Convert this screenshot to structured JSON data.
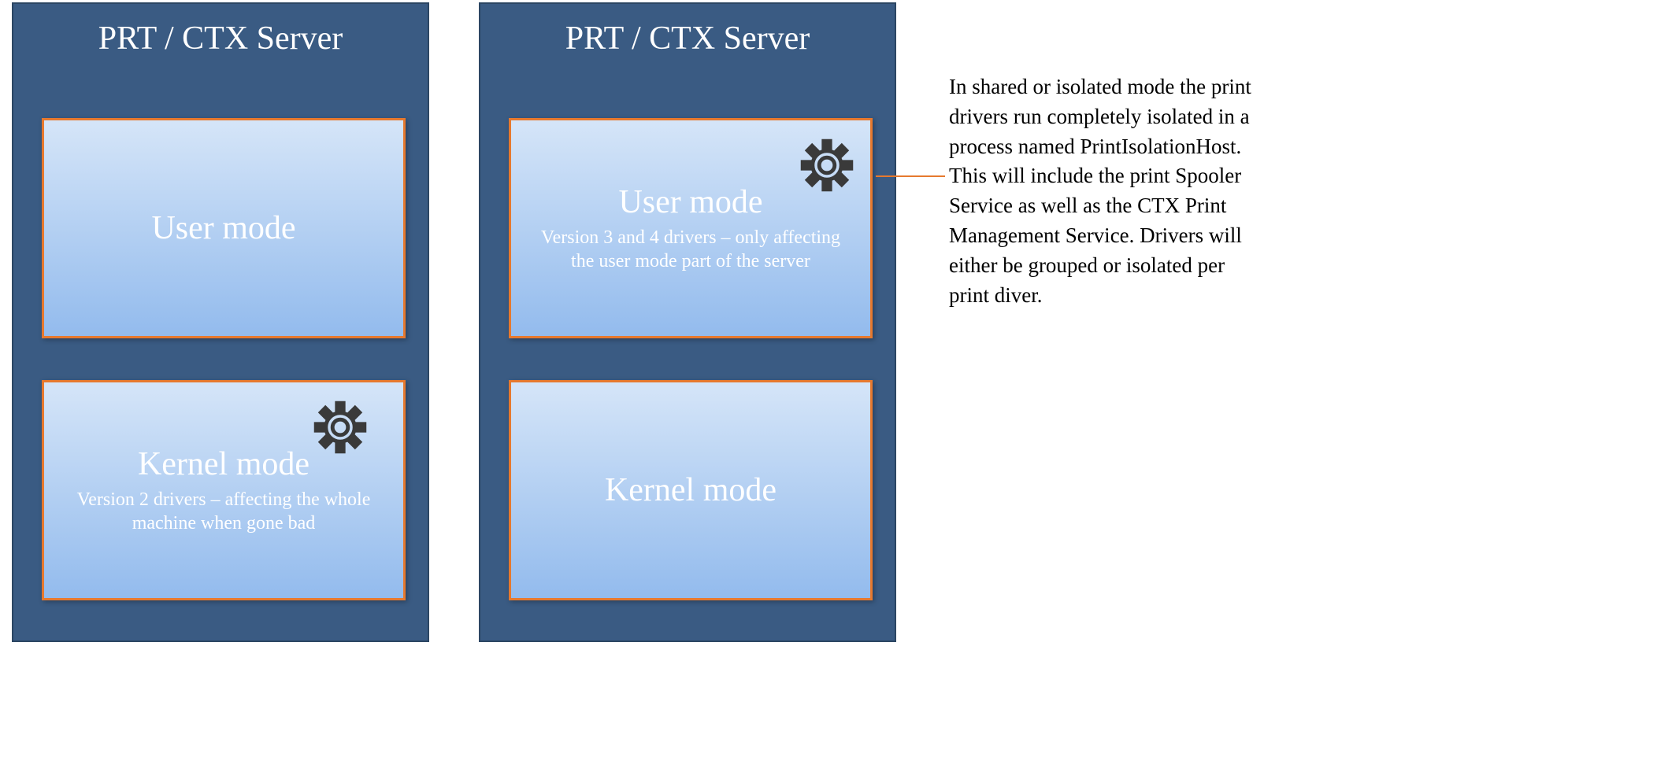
{
  "server1": {
    "title": "PRT / CTX Server",
    "user_mode": {
      "title": "User mode",
      "subtitle": ""
    },
    "kernel_mode": {
      "title": "Kernel mode",
      "subtitle": "Version 2 drivers – affecting the whole machine when gone bad"
    }
  },
  "server2": {
    "title": "PRT / CTX Server",
    "user_mode": {
      "title": "User mode",
      "subtitle": "Version 3 and 4 drivers – only affecting the user mode part of the server"
    },
    "kernel_mode": {
      "title": "Kernel mode",
      "subtitle": ""
    }
  },
  "annotation": "In shared or isolated mode the print drivers run completely isolated in a process named PrintIsolationHost. This will include the print Spooler Service as well as the CTX Print Management Service. Drivers will either be grouped or isolated per print diver."
}
